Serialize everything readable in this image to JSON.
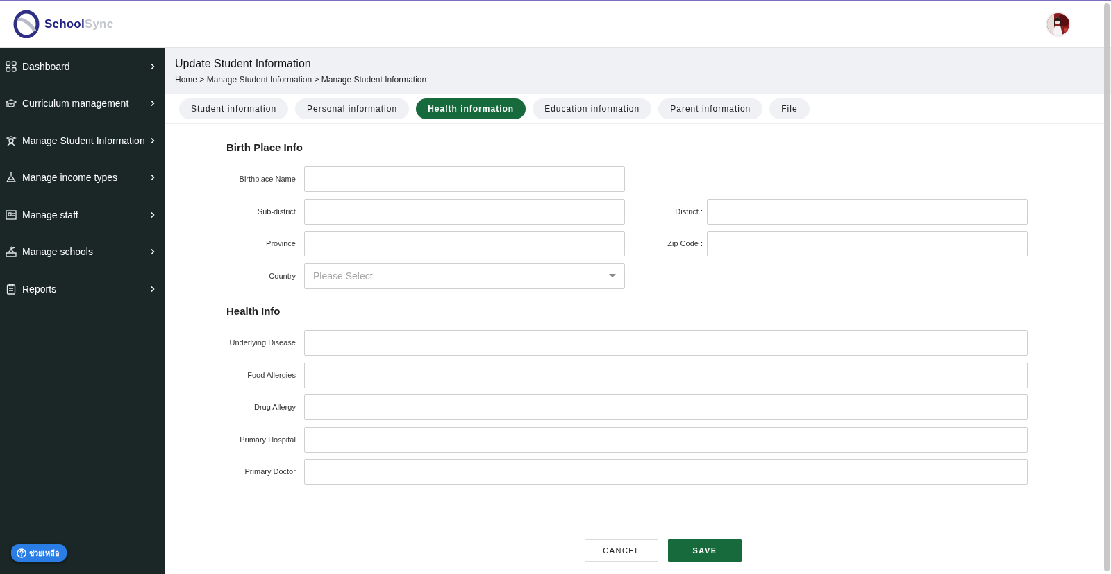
{
  "brand": {
    "primary": "School",
    "secondary": "Sync"
  },
  "sidebar": {
    "items": [
      {
        "label": "Dashboard",
        "expanded": false
      },
      {
        "label": "Curriculum management",
        "expanded": false
      },
      {
        "label": "Manage Student Information",
        "expanded": false
      },
      {
        "label": "Manage income types",
        "expanded": false
      },
      {
        "label": "Manage staff",
        "expanded": false
      },
      {
        "label": "Manage schools",
        "expanded": false
      },
      {
        "label": "Reports",
        "expanded": false
      }
    ]
  },
  "help_button": {
    "label": "ช่วยเหลือ"
  },
  "page": {
    "title": "Update Student Information",
    "breadcrumb": "Home > Manage Student Information > Manage Student Information"
  },
  "tabs": [
    {
      "label": "Student information",
      "selected": false
    },
    {
      "label": "Personal information",
      "selected": false
    },
    {
      "label": "Health information",
      "selected": true
    },
    {
      "label": "Education information",
      "selected": false
    },
    {
      "label": "Parent information",
      "selected": false
    },
    {
      "label": "File",
      "selected": false
    }
  ],
  "sections": [
    {
      "title": "Birth Place Info",
      "rows": [
        [
          {
            "label": "Birthplace Name :",
            "kind": "text",
            "wide": false
          }
        ],
        [
          {
            "label": "Sub-district :",
            "kind": "text",
            "wide": false
          },
          {
            "label": "District :",
            "kind": "text",
            "wide": false
          }
        ],
        [
          {
            "label": "Province :",
            "kind": "text",
            "wide": false
          },
          {
            "label": "Zip Code :",
            "kind": "text",
            "wide": false
          }
        ],
        [
          {
            "label": "Country :",
            "kind": "select",
            "placeholder": "Please Select",
            "wide": false
          }
        ]
      ]
    },
    {
      "title": "Health Info",
      "rows": [
        [
          {
            "label": "Underlying Disease :",
            "kind": "text",
            "wide": true
          }
        ],
        [
          {
            "label": "Food Allergies :",
            "kind": "text",
            "wide": true
          }
        ],
        [
          {
            "label": "Drug Allergy :",
            "kind": "text",
            "wide": true
          }
        ],
        [
          {
            "label": "Primary Hospital :",
            "kind": "text",
            "wide": true
          }
        ],
        [
          {
            "label": "Primary Doctor :",
            "kind": "text",
            "wide": true
          }
        ]
      ]
    }
  ],
  "actions": [
    {
      "label": "CANCEL",
      "kind": "secondary"
    },
    {
      "label": "SAVE",
      "kind": "primary"
    }
  ]
}
